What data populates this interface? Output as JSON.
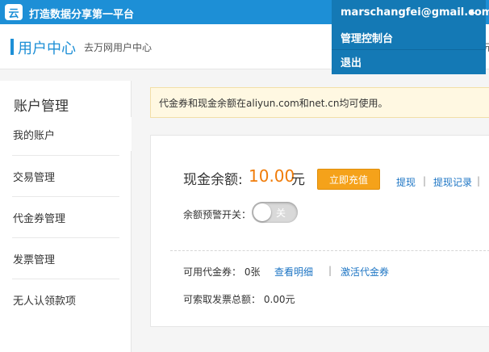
{
  "topbar": {
    "brand": "打造数据分享第一平台",
    "logo_glyph": "云",
    "user_email": "marschangfei@gmail.com"
  },
  "dropdown": {
    "items": [
      "管理控制台",
      "退出"
    ]
  },
  "subheader": {
    "title": "用户中心",
    "description": "去万网用户中心",
    "edge_text": "元"
  },
  "sidebar": {
    "title": "账户管理",
    "items": [
      "我的账户",
      "交易管理",
      "代金券管理",
      "发票管理",
      "无人认领款项"
    ]
  },
  "notice": {
    "text": "代金券和现金余额在aliyun.com和net.cn均可使用。"
  },
  "account": {
    "balance_label": "现金余额:",
    "balance_value": "10.00",
    "balance_unit": "元",
    "recharge_button": "立即充值",
    "withdraw_link": "提现",
    "withdraw_records_link": "提现记录",
    "separator": "|",
    "alert_label": "余额预警开关：",
    "alert_toggle": "关",
    "voucher_label": "可用代金券：  0张",
    "view_details_link": "查看明细",
    "activate_voucher_link": "激活代金券",
    "invoice_label": "可索取发票总额：  0.00元"
  },
  "colors": {
    "primary": "#1d8fd6",
    "menu_dark": "#1479b5",
    "accent_orange": "#f07c0a",
    "button_orange": "#f5a21a",
    "notice_bg": "#fff8e2",
    "link_blue": "#1d75c4"
  }
}
